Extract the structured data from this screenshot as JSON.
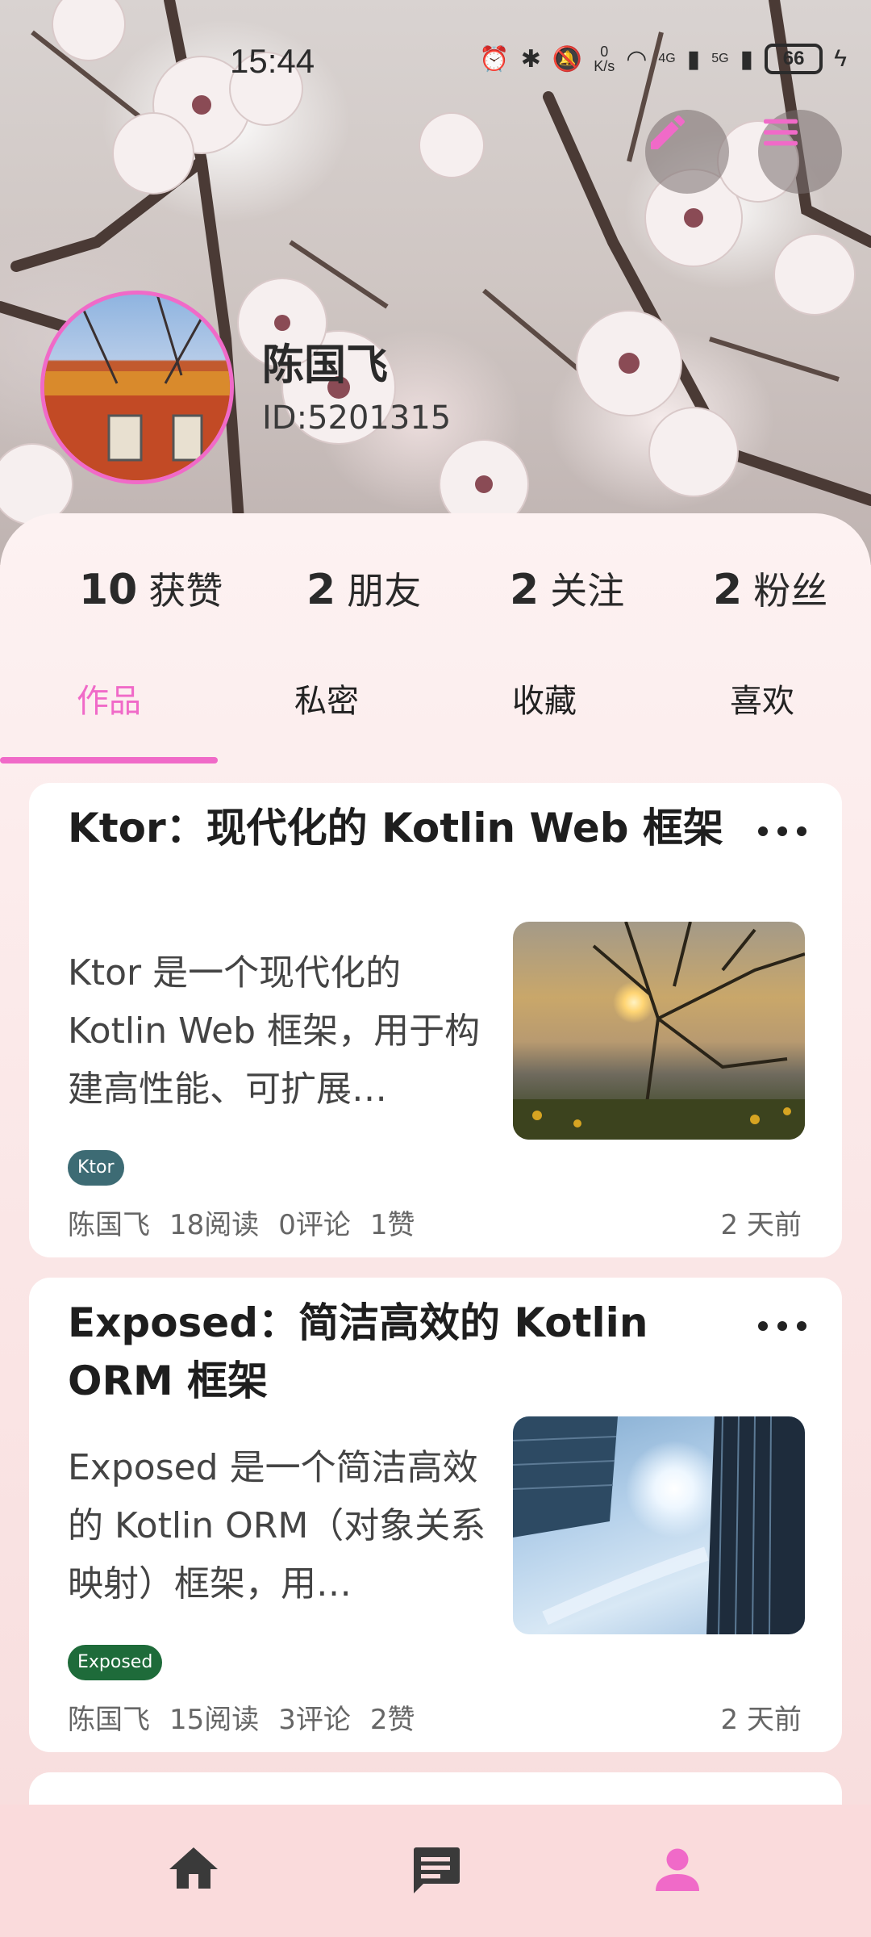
{
  "status_bar": {
    "time": "15:44",
    "net_speed_value": "0",
    "net_speed_unit": "K/s",
    "signal_1": "4G",
    "signal_2": "5G",
    "battery": "66"
  },
  "header": {
    "edit_icon": "pencil-icon",
    "menu_icon": "hamburger-menu-icon",
    "accent_color": "#f06ac8"
  },
  "profile": {
    "name": "陈国飞",
    "id": "ID:5201315"
  },
  "stats": [
    {
      "value": "10",
      "label": "获赞"
    },
    {
      "value": "2",
      "label": "朋友"
    },
    {
      "value": "2",
      "label": "关注"
    },
    {
      "value": "2",
      "label": "粉丝"
    }
  ],
  "tabs": [
    {
      "label": "作品",
      "active": true
    },
    {
      "label": "私密",
      "active": false
    },
    {
      "label": "收藏",
      "active": false
    },
    {
      "label": "喜欢",
      "active": false
    }
  ],
  "posts": [
    {
      "title": "Ktor：现代化的 Kotlin Web 框架",
      "summary": "Ktor 是一个现代化的 Kotlin Web 框架，用于构建高性能、可扩展…",
      "tag": "Ktor",
      "author": "陈国飞",
      "reads": "18阅读",
      "comments": "0评论",
      "likes": "1赞",
      "time": "2 天前"
    },
    {
      "title": "Exposed：简洁高效的 Kotlin ORM 框架",
      "summary": "Exposed 是一个简洁高效的 Kotlin ORM（对象关系映射）框架，用…",
      "tag": "Exposed",
      "author": "陈国飞",
      "reads": "15阅读",
      "comments": "3评论",
      "likes": "2赞",
      "time": "2 天前"
    }
  ],
  "bottom_nav": [
    {
      "icon": "home-icon",
      "active": false
    },
    {
      "icon": "message-icon",
      "active": false
    },
    {
      "icon": "person-icon",
      "active": true
    }
  ]
}
